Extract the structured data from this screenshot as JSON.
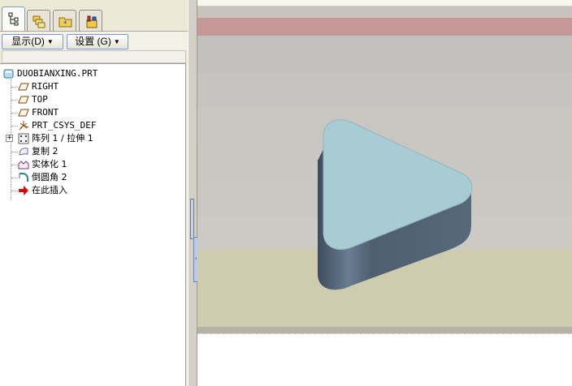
{
  "left_panel": {
    "tabs": [
      {
        "icon": "model-tree-icon",
        "active": true
      },
      {
        "icon": "layers-icon",
        "active": false
      },
      {
        "icon": "folder-browser-icon",
        "active": false
      },
      {
        "icon": "favorites-icon",
        "active": false
      }
    ],
    "buttons": {
      "show_label": "显示",
      "show_accel": "(D)",
      "settings_label": "设置",
      "settings_accel": "(G)"
    },
    "tree": {
      "root": "DUOBIANXING.PRT",
      "items": [
        {
          "label": "RIGHT",
          "icon": "datum-plane-icon"
        },
        {
          "label": "TOP",
          "icon": "datum-plane-icon"
        },
        {
          "label": "FRONT",
          "icon": "datum-plane-icon"
        },
        {
          "label": "PRT_CSYS_DEF",
          "icon": "coordinate-system-icon"
        },
        {
          "label": "阵列 1 / 拉伸 1",
          "icon": "pattern-icon",
          "expandable": true
        },
        {
          "label": "复制 2",
          "icon": "copy-feature-icon"
        },
        {
          "label": "实体化 1",
          "icon": "solidify-icon"
        },
        {
          "label": "倒圆角 2",
          "icon": "round-icon"
        },
        {
          "label": "在此插入",
          "icon": "insert-here-arrow-icon"
        }
      ]
    }
  },
  "colors": {
    "part_top_face": "#a9ccd4",
    "part_side_face": "#56687a",
    "insert_arrow": "#e00000",
    "background_red_band": "#c69898",
    "floor": "#cecbae"
  }
}
